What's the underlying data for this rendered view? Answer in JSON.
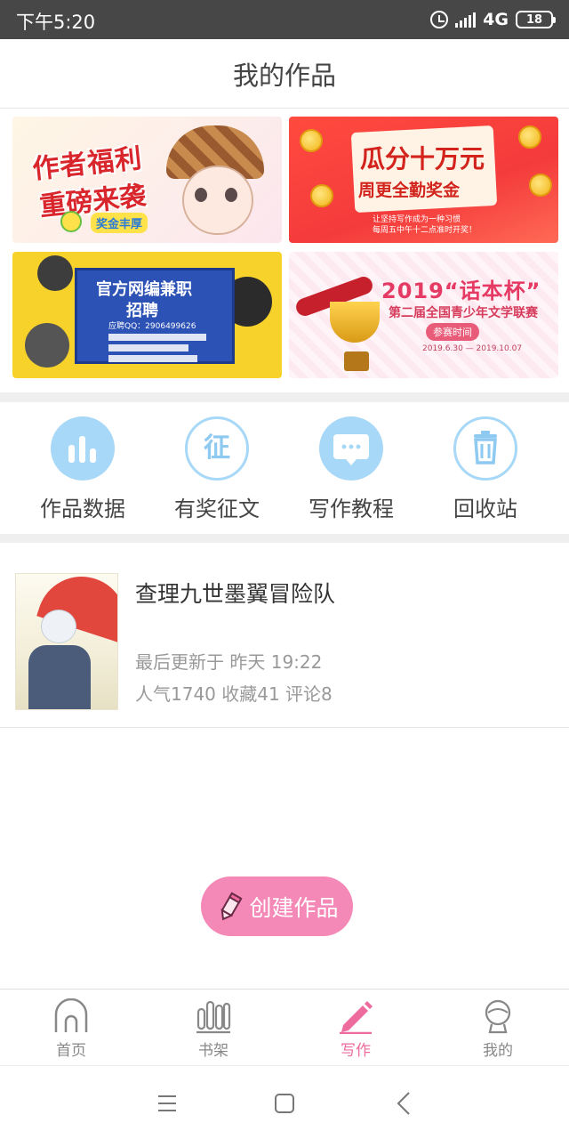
{
  "status_bar": {
    "time": "下午5:20",
    "network": "4G",
    "battery": "18"
  },
  "header": {
    "title": "我的作品"
  },
  "banners": {
    "welfare": {
      "line1": "作者福利",
      "line2": "重磅来袭",
      "tag": "奖金丰厚"
    },
    "bonus": {
      "line1": "瓜分十万元",
      "line2": "周更全勤奖金",
      "sub1": "让坚持写作成为一种习惯",
      "sub2": "每周五中午十二点准时开奖！"
    },
    "recruit": {
      "line1": "官方网编兼职",
      "line2": "招聘",
      "qq": "应聘QQ：2906499626"
    },
    "contest": {
      "title": "2019“话本杯”",
      "subtitle": "第二届全国青少年文学联赛",
      "label": "参赛时间",
      "dates": "2019.6.30 — 2019.10.07"
    }
  },
  "quick_menu": [
    {
      "label": "作品数据",
      "icon": "bar-chart-icon"
    },
    {
      "label": "有奖征文",
      "icon": "zheng-icon",
      "glyph": "征"
    },
    {
      "label": "写作教程",
      "icon": "chat-bubble-icon"
    },
    {
      "label": "回收站",
      "icon": "trash-icon"
    }
  ],
  "works": [
    {
      "title": "查理九世墨翼冒险队",
      "updated": "最后更新于 昨天 19:22",
      "stats": "人气1740 收藏41 评论8"
    }
  ],
  "create_button": {
    "label": "创建作品"
  },
  "tabs": [
    {
      "label": "首页",
      "icon": "home-icon",
      "active": false
    },
    {
      "label": "书架",
      "icon": "bookshelf-icon",
      "active": false
    },
    {
      "label": "写作",
      "icon": "pencil-icon",
      "active": true
    },
    {
      "label": "我的",
      "icon": "profile-icon",
      "active": false
    }
  ],
  "colors": {
    "accent": "#ee6b9e",
    "icon_blue": "#a8d8f7",
    "status_bar": "#474747"
  }
}
